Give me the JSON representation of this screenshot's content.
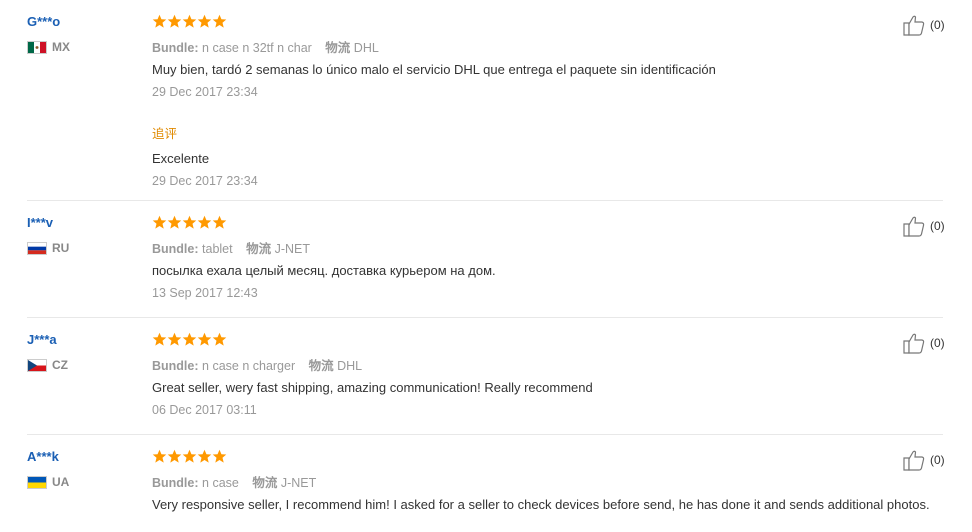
{
  "reviews": [
    {
      "user": "G***o",
      "country": "MX",
      "flag": "mx",
      "rating": 5,
      "bundle_label": "Bundle:",
      "bundle_value": "n case n 32tf n char",
      "logistics_label": "物流",
      "logistics_value": "DHL",
      "text": "Muy bien, tardó 2 semanas lo único malo el servicio DHL que entrega el paquete sin identificación",
      "date": "29 Dec 2017 23:34",
      "followup_label": "追评",
      "followup_text": "Excelente",
      "followup_date": "29 Dec 2017 23:34",
      "likes": "(0)"
    },
    {
      "user": "I***v",
      "country": "RU",
      "flag": "ru",
      "rating": 5,
      "bundle_label": "Bundle:",
      "bundle_value": "tablet",
      "logistics_label": "物流",
      "logistics_value": "J-NET",
      "text": "посылка ехала целый месяц. доставка курьером на дом.",
      "date": "13 Sep 2017 12:43",
      "likes": "(0)"
    },
    {
      "user": "J***a",
      "country": "CZ",
      "flag": "cz",
      "rating": 5,
      "bundle_label": "Bundle:",
      "bundle_value": "n case n charger",
      "logistics_label": "物流",
      "logistics_value": "DHL",
      "text": "Great seller, wery fast shipping, amazing communication! Really recommend",
      "date": "06 Dec 2017 03:11",
      "likes": "(0)"
    },
    {
      "user": "A***k",
      "country": "UA",
      "flag": "ua",
      "rating": 5,
      "bundle_label": "Bundle:",
      "bundle_value": "n case",
      "logistics_label": "物流",
      "logistics_value": "J-NET",
      "text": "Very responsive seller, I recommend him! I asked for a seller to check devices before send, he has done it and sends additional photos.",
      "likes": "(0)"
    }
  ],
  "colors": {
    "star": "#ff9900",
    "username": "#1a5fb4",
    "followup": "#e08a00"
  },
  "icons": {
    "rating": "star-icon",
    "like": "thumbs-up-icon"
  }
}
